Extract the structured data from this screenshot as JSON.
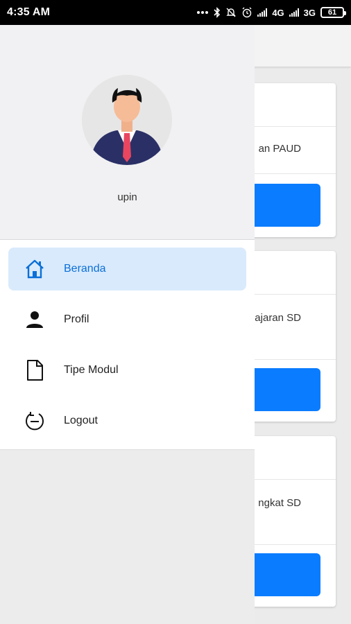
{
  "status_bar": {
    "time": "4:35 AM",
    "network_1": "4G",
    "network_2": "3G",
    "battery": "61"
  },
  "drawer": {
    "username": "upin",
    "items": [
      {
        "label": "Beranda",
        "icon": "home-icon",
        "active": true
      },
      {
        "label": "Profil",
        "icon": "person-icon",
        "active": false
      },
      {
        "label": "Tipe Modul",
        "icon": "document-icon",
        "active": false
      },
      {
        "label": "Logout",
        "icon": "logout-icon",
        "active": false
      }
    ]
  },
  "background": {
    "cards": [
      {
        "text": "an PAUD"
      },
      {
        "text": "ajaran SD"
      },
      {
        "text": "ngkat SD"
      }
    ]
  },
  "colors": {
    "accent": "#0a7cff",
    "active_bg": "#d9eafc",
    "active_text": "#0a6fd8"
  }
}
